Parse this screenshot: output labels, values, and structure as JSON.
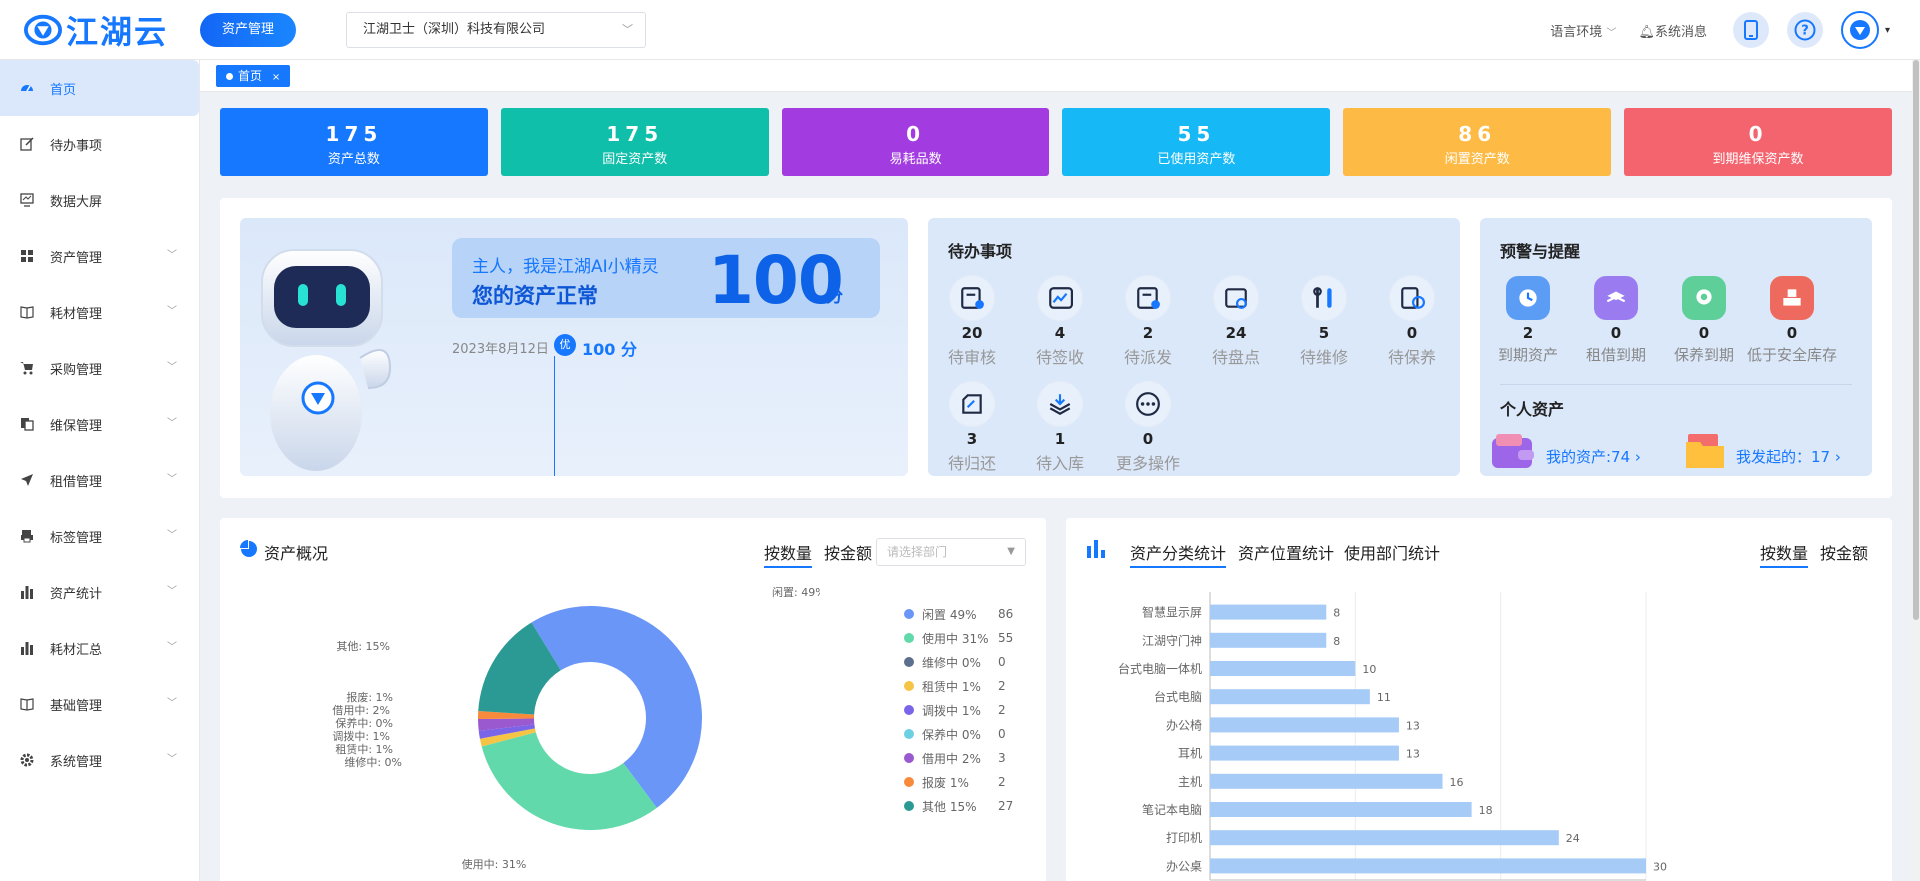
{
  "header": {
    "logo_text": "江湖云",
    "module_button": "资产管理",
    "company": "江湖卫士（深圳）科技有限公司",
    "language": "语言环境",
    "messages": "系统消息"
  },
  "sidebar": {
    "items": [
      {
        "label": "首页",
        "icon": "dashboard-icon",
        "active": true
      },
      {
        "label": "待办事项",
        "icon": "edit-icon"
      },
      {
        "label": "数据大屏",
        "icon": "monitor-icon"
      },
      {
        "label": "资产管理",
        "icon": "grid-icon",
        "expandable": true
      },
      {
        "label": "耗材管理",
        "icon": "book-icon",
        "expandable": true
      },
      {
        "label": "采购管理",
        "icon": "cart-icon",
        "expandable": true
      },
      {
        "label": "维保管理",
        "icon": "copy-icon",
        "expandable": true
      },
      {
        "label": "租借管理",
        "icon": "send-icon",
        "expandable": true
      },
      {
        "label": "标签管理",
        "icon": "printer-icon",
        "expandable": true
      },
      {
        "label": "资产统计",
        "icon": "bar-chart-icon",
        "expandable": true
      },
      {
        "label": "耗材汇总",
        "icon": "bar-chart-icon",
        "expandable": true
      },
      {
        "label": "基础管理",
        "icon": "book-icon",
        "expandable": true
      },
      {
        "label": "系统管理",
        "icon": "gear-icon",
        "expandable": true
      }
    ]
  },
  "tabs": {
    "home": "首页"
  },
  "stats": [
    {
      "value": "175",
      "label": "资产总数",
      "color": "#1677ff"
    },
    {
      "value": "175",
      "label": "固定资产数",
      "color": "#0fbfa9"
    },
    {
      "value": "0",
      "label": "易耗品数",
      "color": "#a23be0"
    },
    {
      "value": "55",
      "label": "已使用资产数",
      "color": "#16b9f6"
    },
    {
      "value": "86",
      "label": "闲置资产数",
      "color": "#fdbb45"
    },
    {
      "value": "0",
      "label": "到期维保资产数",
      "color": "#f4646f"
    }
  ],
  "ai": {
    "greeting": "主人，我是江湖AI小精灵",
    "status": "您的资产正常",
    "score": "100",
    "score_unit": "分",
    "date": "2023年8月12日",
    "grade": "优",
    "grade_score": "100 分"
  },
  "todo": {
    "title": "待办事项",
    "items": [
      {
        "count": "20",
        "label": "待审核",
        "icon": "audit-icon"
      },
      {
        "count": "4",
        "label": "待签收",
        "icon": "sign-icon"
      },
      {
        "count": "2",
        "label": "待派发",
        "icon": "dispatch-icon"
      },
      {
        "count": "24",
        "label": "待盘点",
        "icon": "inventory-icon"
      },
      {
        "count": "5",
        "label": "待维修",
        "icon": "repair-icon"
      },
      {
        "count": "0",
        "label": "待保养",
        "icon": "maintain-icon"
      },
      {
        "count": "3",
        "label": "待归还",
        "icon": "return-icon"
      },
      {
        "count": "1",
        "label": "待入库",
        "icon": "stock-in-icon"
      },
      {
        "count": "0",
        "label": "更多操作",
        "icon": "more-icon"
      }
    ]
  },
  "warning": {
    "title": "预警与提醒",
    "items": [
      {
        "count": "2",
        "label": "到期资产",
        "icon": "clock-icon",
        "color": "#5b9df5"
      },
      {
        "count": "0",
        "label": "租借到期",
        "icon": "handshake-icon",
        "color": "#9b7cf0"
      },
      {
        "count": "0",
        "label": "保养到期",
        "icon": "badge-icon",
        "color": "#5fcf9a"
      },
      {
        "count": "0",
        "label": "低于安全库存",
        "icon": "cubes-icon",
        "color": "#ef6a5e"
      }
    ],
    "personal_title": "个人资产",
    "my_assets": "我的资产:74 ›",
    "my_started": "我发起的：17 ›"
  },
  "overview": {
    "title": "资产概况",
    "by_count": "按数量",
    "by_amount": "按金额",
    "dept_placeholder": "请选择部门"
  },
  "right_chart": {
    "tabs": [
      "资产分类统计",
      "资产位置统计",
      "使用部门统计"
    ],
    "by_count": "按数量",
    "by_amount": "按金额"
  },
  "chart_data": [
    {
      "type": "pie",
      "categories": [
        "闲置",
        "使用中",
        "维修中",
        "租赁中",
        "调拨中",
        "保养中",
        "借用中",
        "报废",
        "其他"
      ],
      "values": [
        86,
        55,
        0,
        2,
        2,
        0,
        3,
        2,
        27
      ],
      "percents": [
        "49%",
        "31%",
        "0%",
        "1%",
        "1%",
        "0%",
        "2%",
        "1%",
        "15%"
      ],
      "colors": [
        "#6996f7",
        "#62d9ab",
        "#5c6f8c",
        "#f6c445",
        "#7a64e8",
        "#6ad0e2",
        "#9b59d0",
        "#f78b3b",
        "#2b9a94"
      ]
    },
    {
      "type": "bar",
      "orientation": "horizontal",
      "categories": [
        "智慧显示屏",
        "江湖守门神",
        "台式电脑一体机",
        "台式电脑",
        "办公椅",
        "耳机",
        "主机",
        "笔记本电脑",
        "打印机",
        "办公桌"
      ],
      "values": [
        8,
        8,
        10,
        11,
        13,
        13,
        16,
        18,
        24,
        30
      ],
      "xticks": [
        "0",
        "10",
        "20",
        "30"
      ],
      "xlim": [
        0,
        30
      ],
      "color": "#a5cbf6"
    }
  ]
}
